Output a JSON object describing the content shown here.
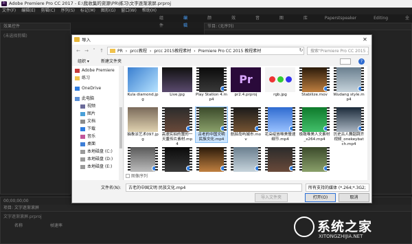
{
  "window": {
    "title": "Adobe Premiere Pro CC 2017 - E:\\我收集的资源\\PR\\练习\\文字逐渐滚屏.prproj",
    "icon_text": "Pr"
  },
  "menu": [
    "文件(F)",
    "编辑(E)",
    "剪辑(C)",
    "序列(S)",
    "标记(M)",
    "图形(G)",
    "窗口(W)",
    "帮助(H)"
  ],
  "workspaces": [
    "组件",
    "编辑",
    "颜色",
    "效果",
    "音频",
    "图形",
    "库",
    "Paperstspeaker",
    "Editing",
    "全部"
  ],
  "panels": {
    "left_tab": "效果控件",
    "left_sub": "(未选择剪辑)",
    "right_tab": "节目: (无序列)",
    "bottom_time": "00;00;00;00",
    "project_tab": "项目: 文字逐渐滚屏",
    "project_file": "文字逐渐滚屏.prproj",
    "col_name": "名称",
    "col_rate": "帧速率"
  },
  "dialog": {
    "title": "导入",
    "close": "✕",
    "breadcrumb": [
      "PR",
      "prcc教程",
      "prcc 2015教程素材",
      "Premiere Pro CC 2015 教程素材"
    ],
    "search_placeholder": "搜索\"Premiere Pro CC 2015 ...\"",
    "organize": "组织 ▾",
    "new_folder": "新建文件夹",
    "nav": [
      "Adobe Premiere",
      "练习",
      "OneDrive",
      "此电脑",
      "视频",
      "图片",
      "文档",
      "下载",
      "音乐",
      "桌面",
      "本地磁盘 (C:)",
      "本地磁盘 (D:)",
      "本地磁盘 (E:)"
    ],
    "files": [
      {
        "name": "Kula diamond.jpg",
        "kind": "img"
      },
      {
        "name": "Live.jpg",
        "kind": "img"
      },
      {
        "name": "Play Station 4.mp4",
        "kind": "video"
      },
      {
        "name": "pr2.4.prproj",
        "kind": "pr"
      },
      {
        "name": "rgb.jpg",
        "kind": "rgb"
      },
      {
        "name": "Stabilize.mov",
        "kind": "video"
      },
      {
        "name": "Wudang style.mp4",
        "kind": "video"
      },
      {
        "name": "抽象派艺术097.jpg",
        "kind": "img"
      },
      {
        "name": "高速实拍的置的一天董传片素材.mp4",
        "kind": "video"
      },
      {
        "name": "古老的中国文明 民族文化.mp4",
        "kind": "video",
        "selected": true
      },
      {
        "name": "航拍岛屿城市.mov",
        "kind": "video"
      },
      {
        "name": "花朵绽放唯美慢速细节.mp4",
        "kind": "video"
      },
      {
        "name": "极致唯美人文素材_x264.mp4",
        "kind": "video"
      },
      {
        "name": "历史古人舞蹈跳齐视频_onekeybatch.mp4",
        "kind": "video"
      },
      {
        "name": "",
        "kind": "video"
      },
      {
        "name": "",
        "kind": "video"
      },
      {
        "name": "",
        "kind": "video"
      },
      {
        "name": "",
        "kind": "video"
      },
      {
        "name": "",
        "kind": "video"
      },
      {
        "name": "",
        "kind": "video"
      }
    ],
    "preview_label": "图像序列",
    "filename_label": "文件名(N):",
    "filename_value": "古老的中国文明 民族文化.mp4",
    "filetype_value": "所有支持的媒体 (*.264;*.3G2;",
    "import_folder": "导入文件夹",
    "open": "打开(O)",
    "cancel": "取消"
  },
  "watermark": {
    "text": "系统之家",
    "url": "XITONGZHIJIA.NET"
  },
  "colors": {
    "accent": "#4aa3ff",
    "selection": "#cce5ff",
    "pr_purple": "#2a0a3a"
  }
}
